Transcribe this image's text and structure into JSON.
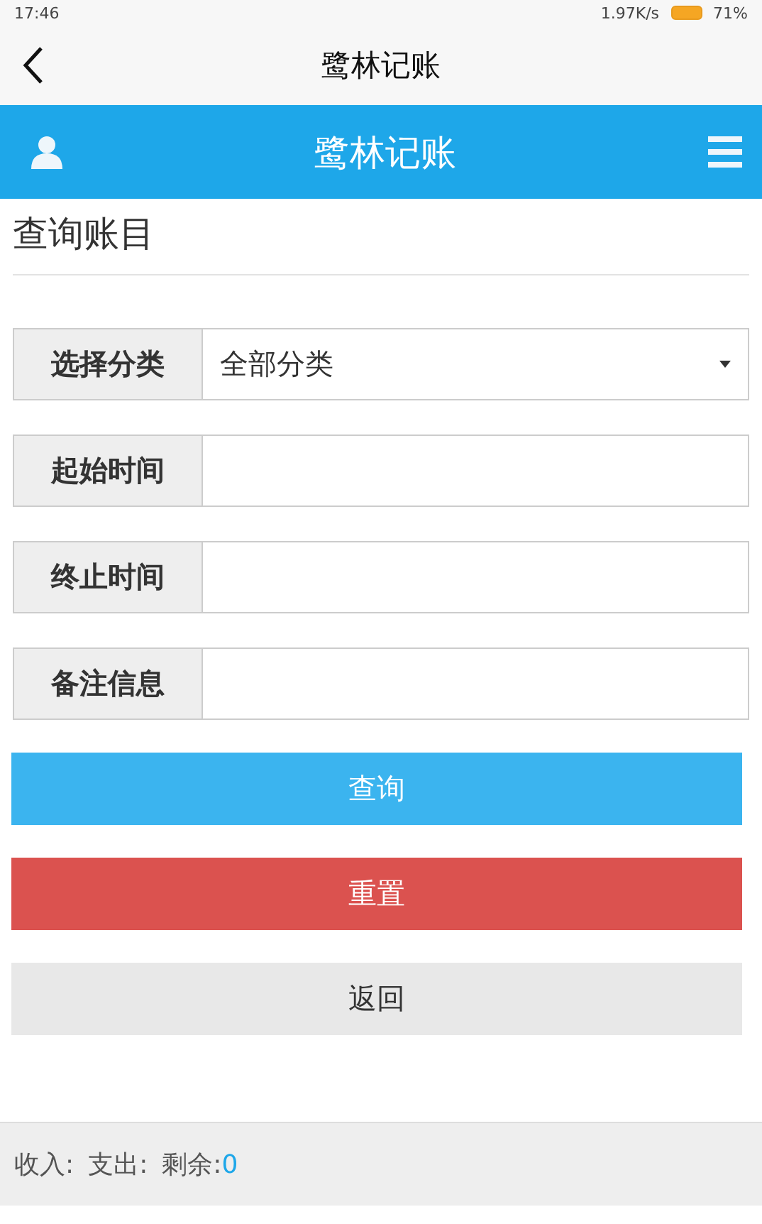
{
  "status_bar": {
    "time": "17:46",
    "speed": "1.97K/s",
    "battery": "71%"
  },
  "nav_bar": {
    "title": "鹭林记账"
  },
  "header": {
    "title": "鹭林记账"
  },
  "heading": "查询账目",
  "form": [
    {
      "kind": "select",
      "label": "选择分类",
      "value": "全部分类"
    },
    {
      "kind": "input",
      "label": "起始时间"
    },
    {
      "kind": "input",
      "label": "终止时间"
    },
    {
      "kind": "input",
      "label": "备注信息"
    }
  ],
  "buttons": [
    {
      "kind": "primary",
      "label": "查询"
    },
    {
      "kind": "danger",
      "label": "重置"
    },
    {
      "kind": "default",
      "label": "返回"
    }
  ],
  "footer": {
    "income_label": "收入:",
    "expense_label": "支出:",
    "balance_label": "剩余:",
    "balance": "0"
  }
}
